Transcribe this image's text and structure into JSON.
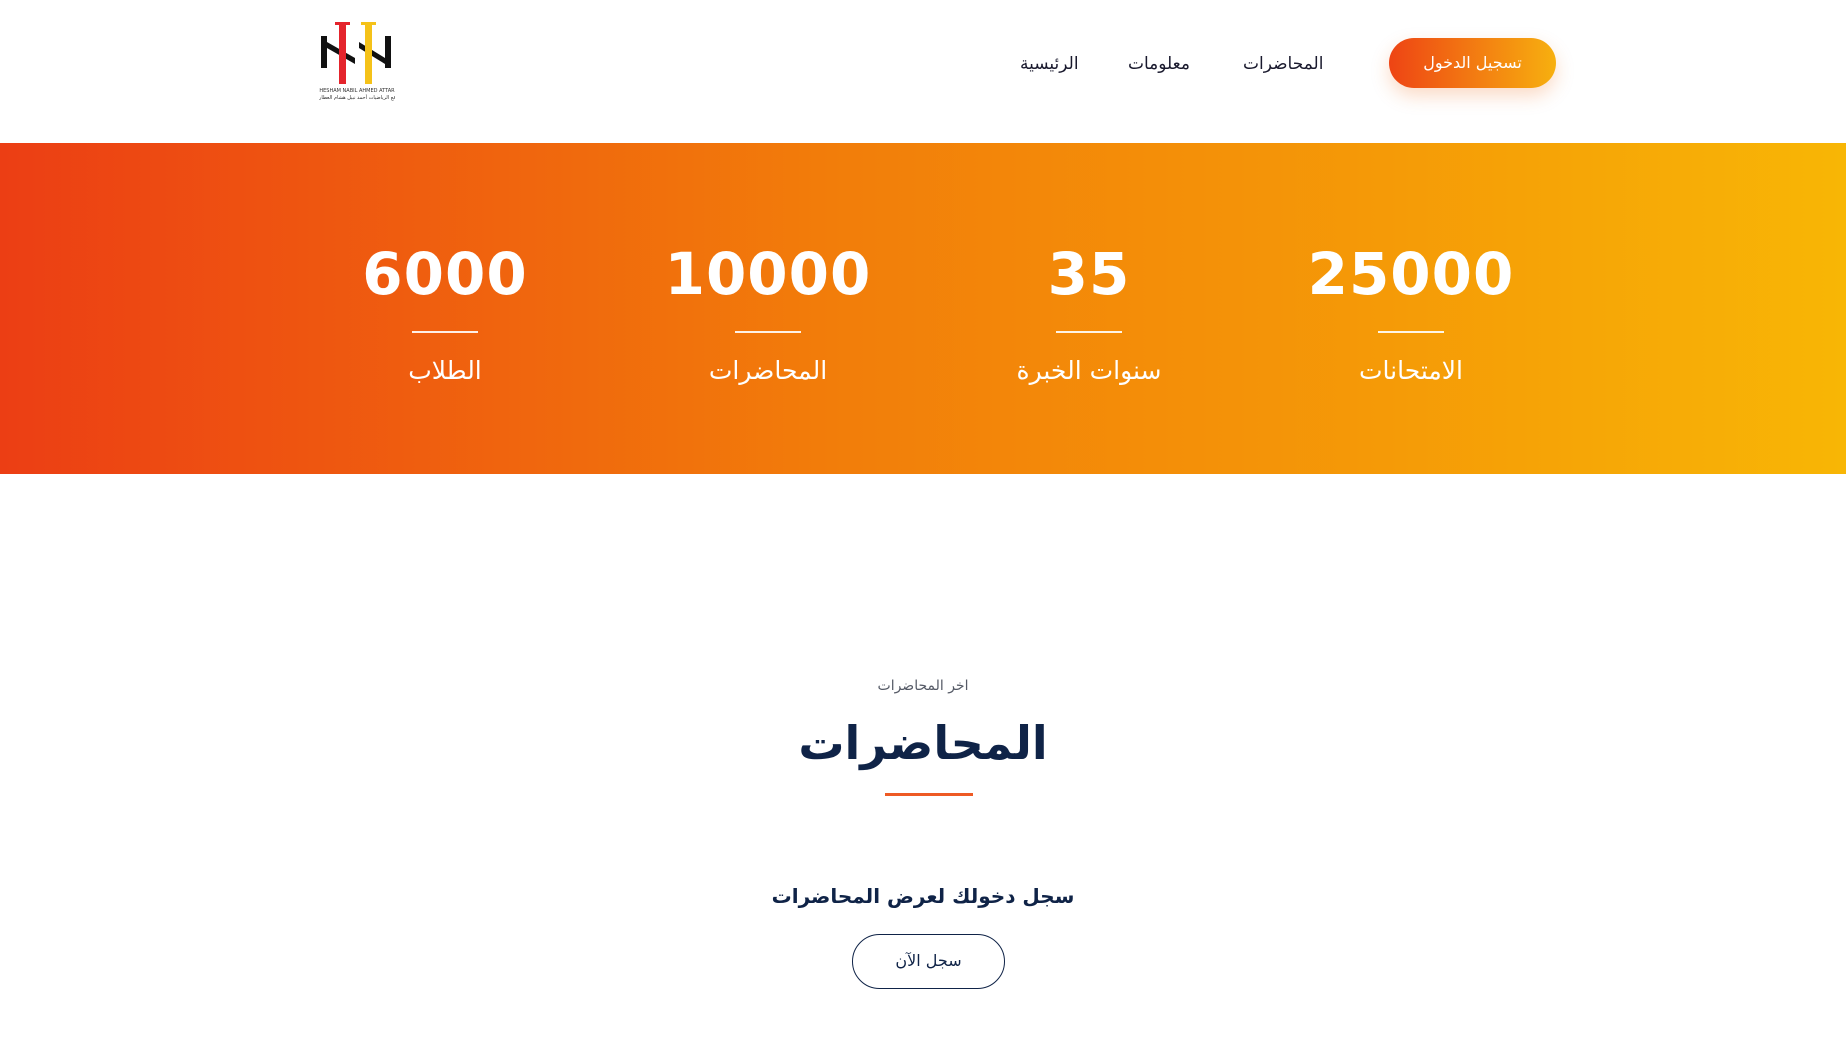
{
  "header": {
    "logo": {
      "name": "hh-logo-icon",
      "caption_line1": "HESHAM NABIL AHMED ATTAR",
      "caption_line2": "موقع الرياضيات أحمد نبيل هشام العطار"
    },
    "nav": {
      "home": "الرئيسية",
      "info": "معلومات",
      "lectures": "المحاضرات"
    },
    "login_button": "تسجيل الدخول"
  },
  "stats": [
    {
      "number": "6000",
      "label": "الطلاب"
    },
    {
      "number": "10000",
      "label": "المحاضرات"
    },
    {
      "number": "35",
      "label": "سنوات الخبرة"
    },
    {
      "number": "25000",
      "label": "الامتحانات"
    }
  ],
  "lectures_section": {
    "eyebrow": "اخر المحاضرات",
    "title": "المحاضرات",
    "login_prompt": "سجل دخولك لعرض المحاضرات",
    "register_button": "سجل الآن"
  },
  "colors": {
    "brand_gradient_start": "#ee4414",
    "brand_gradient_end": "#f7b00f",
    "navy": "#0f2347",
    "accent_line": "#ee5a24"
  }
}
